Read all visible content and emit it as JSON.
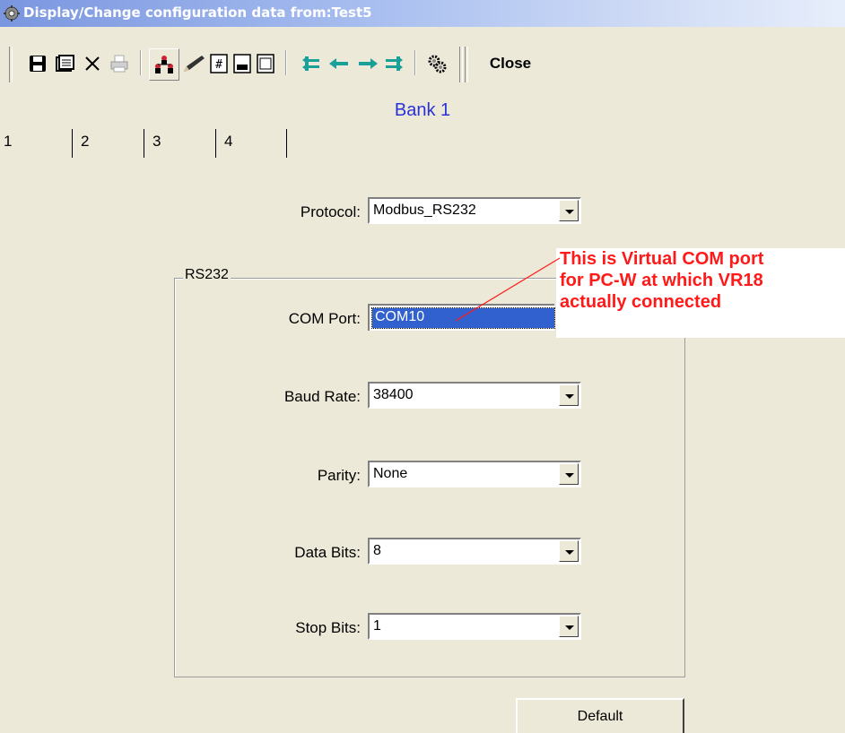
{
  "window": {
    "title": "Display/Change configuration data from:Test5"
  },
  "toolbar": {
    "icons": [
      "save-icon",
      "copy-icon",
      "delete-icon",
      "print-icon",
      "network-icon",
      "edit-icon",
      "number-icon",
      "page-icon",
      "first-icon",
      "prev-icon",
      "next-icon",
      "last-icon",
      "settings-icon"
    ],
    "close_label": "Close"
  },
  "bank_title": "Bank 1",
  "tabs": [
    {
      "label": "1",
      "selected": true
    },
    {
      "label": "2",
      "selected": false
    },
    {
      "label": "3",
      "selected": false
    },
    {
      "label": "4",
      "selected": false
    }
  ],
  "protocol": {
    "label": "Protocol:",
    "value": "Modbus_RS232"
  },
  "group": {
    "title": "RS232",
    "com_port": {
      "label": "COM Port:",
      "value": "COM10"
    },
    "baud_rate": {
      "label": "Baud Rate:",
      "value": "38400"
    },
    "parity": {
      "label": "Parity:",
      "value": "None"
    },
    "data_bits": {
      "label": "Data Bits:",
      "value": "8"
    },
    "stop_bits": {
      "label": "Stop Bits:",
      "value": "1"
    }
  },
  "annotation": {
    "lines": [
      "This is Virtual COM port",
      "for PC-W at which VR18",
      "actually connected"
    ],
    "color": "#ff1a1a"
  },
  "default_button": "Default",
  "colors": {
    "title_gradient_start": "#7a96df",
    "bank_title": "#2a32d6",
    "selection": "#3161cf",
    "teal_arrows": "#19a098"
  }
}
